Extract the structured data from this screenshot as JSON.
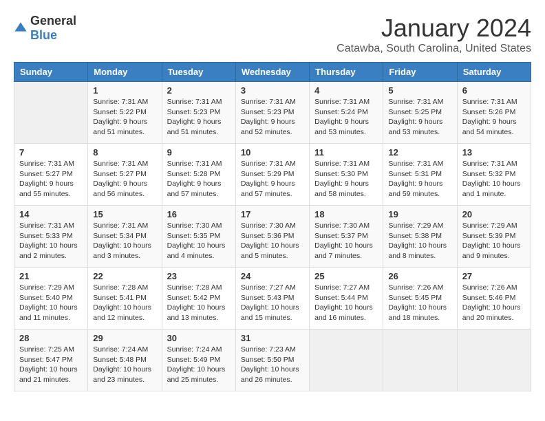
{
  "logo": {
    "general": "General",
    "blue": "Blue"
  },
  "header": {
    "month": "January 2024",
    "location": "Catawba, South Carolina, United States"
  },
  "weekdays": [
    "Sunday",
    "Monday",
    "Tuesday",
    "Wednesday",
    "Thursday",
    "Friday",
    "Saturday"
  ],
  "weeks": [
    [
      {
        "day": "",
        "info": ""
      },
      {
        "day": "1",
        "info": "Sunrise: 7:31 AM\nSunset: 5:22 PM\nDaylight: 9 hours\nand 51 minutes."
      },
      {
        "day": "2",
        "info": "Sunrise: 7:31 AM\nSunset: 5:23 PM\nDaylight: 9 hours\nand 51 minutes."
      },
      {
        "day": "3",
        "info": "Sunrise: 7:31 AM\nSunset: 5:23 PM\nDaylight: 9 hours\nand 52 minutes."
      },
      {
        "day": "4",
        "info": "Sunrise: 7:31 AM\nSunset: 5:24 PM\nDaylight: 9 hours\nand 53 minutes."
      },
      {
        "day": "5",
        "info": "Sunrise: 7:31 AM\nSunset: 5:25 PM\nDaylight: 9 hours\nand 53 minutes."
      },
      {
        "day": "6",
        "info": "Sunrise: 7:31 AM\nSunset: 5:26 PM\nDaylight: 9 hours\nand 54 minutes."
      }
    ],
    [
      {
        "day": "7",
        "info": "Sunrise: 7:31 AM\nSunset: 5:27 PM\nDaylight: 9 hours\nand 55 minutes."
      },
      {
        "day": "8",
        "info": "Sunrise: 7:31 AM\nSunset: 5:27 PM\nDaylight: 9 hours\nand 56 minutes."
      },
      {
        "day": "9",
        "info": "Sunrise: 7:31 AM\nSunset: 5:28 PM\nDaylight: 9 hours\nand 57 minutes."
      },
      {
        "day": "10",
        "info": "Sunrise: 7:31 AM\nSunset: 5:29 PM\nDaylight: 9 hours\nand 57 minutes."
      },
      {
        "day": "11",
        "info": "Sunrise: 7:31 AM\nSunset: 5:30 PM\nDaylight: 9 hours\nand 58 minutes."
      },
      {
        "day": "12",
        "info": "Sunrise: 7:31 AM\nSunset: 5:31 PM\nDaylight: 9 hours\nand 59 minutes."
      },
      {
        "day": "13",
        "info": "Sunrise: 7:31 AM\nSunset: 5:32 PM\nDaylight: 10 hours\nand 1 minute."
      }
    ],
    [
      {
        "day": "14",
        "info": "Sunrise: 7:31 AM\nSunset: 5:33 PM\nDaylight: 10 hours\nand 2 minutes."
      },
      {
        "day": "15",
        "info": "Sunrise: 7:31 AM\nSunset: 5:34 PM\nDaylight: 10 hours\nand 3 minutes."
      },
      {
        "day": "16",
        "info": "Sunrise: 7:30 AM\nSunset: 5:35 PM\nDaylight: 10 hours\nand 4 minutes."
      },
      {
        "day": "17",
        "info": "Sunrise: 7:30 AM\nSunset: 5:36 PM\nDaylight: 10 hours\nand 5 minutes."
      },
      {
        "day": "18",
        "info": "Sunrise: 7:30 AM\nSunset: 5:37 PM\nDaylight: 10 hours\nand 7 minutes."
      },
      {
        "day": "19",
        "info": "Sunrise: 7:29 AM\nSunset: 5:38 PM\nDaylight: 10 hours\nand 8 minutes."
      },
      {
        "day": "20",
        "info": "Sunrise: 7:29 AM\nSunset: 5:39 PM\nDaylight: 10 hours\nand 9 minutes."
      }
    ],
    [
      {
        "day": "21",
        "info": "Sunrise: 7:29 AM\nSunset: 5:40 PM\nDaylight: 10 hours\nand 11 minutes."
      },
      {
        "day": "22",
        "info": "Sunrise: 7:28 AM\nSunset: 5:41 PM\nDaylight: 10 hours\nand 12 minutes."
      },
      {
        "day": "23",
        "info": "Sunrise: 7:28 AM\nSunset: 5:42 PM\nDaylight: 10 hours\nand 13 minutes."
      },
      {
        "day": "24",
        "info": "Sunrise: 7:27 AM\nSunset: 5:43 PM\nDaylight: 10 hours\nand 15 minutes."
      },
      {
        "day": "25",
        "info": "Sunrise: 7:27 AM\nSunset: 5:44 PM\nDaylight: 10 hours\nand 16 minutes."
      },
      {
        "day": "26",
        "info": "Sunrise: 7:26 AM\nSunset: 5:45 PM\nDaylight: 10 hours\nand 18 minutes."
      },
      {
        "day": "27",
        "info": "Sunrise: 7:26 AM\nSunset: 5:46 PM\nDaylight: 10 hours\nand 20 minutes."
      }
    ],
    [
      {
        "day": "28",
        "info": "Sunrise: 7:25 AM\nSunset: 5:47 PM\nDaylight: 10 hours\nand 21 minutes."
      },
      {
        "day": "29",
        "info": "Sunrise: 7:24 AM\nSunset: 5:48 PM\nDaylight: 10 hours\nand 23 minutes."
      },
      {
        "day": "30",
        "info": "Sunrise: 7:24 AM\nSunset: 5:49 PM\nDaylight: 10 hours\nand 25 minutes."
      },
      {
        "day": "31",
        "info": "Sunrise: 7:23 AM\nSunset: 5:50 PM\nDaylight: 10 hours\nand 26 minutes."
      },
      {
        "day": "",
        "info": ""
      },
      {
        "day": "",
        "info": ""
      },
      {
        "day": "",
        "info": ""
      }
    ]
  ]
}
